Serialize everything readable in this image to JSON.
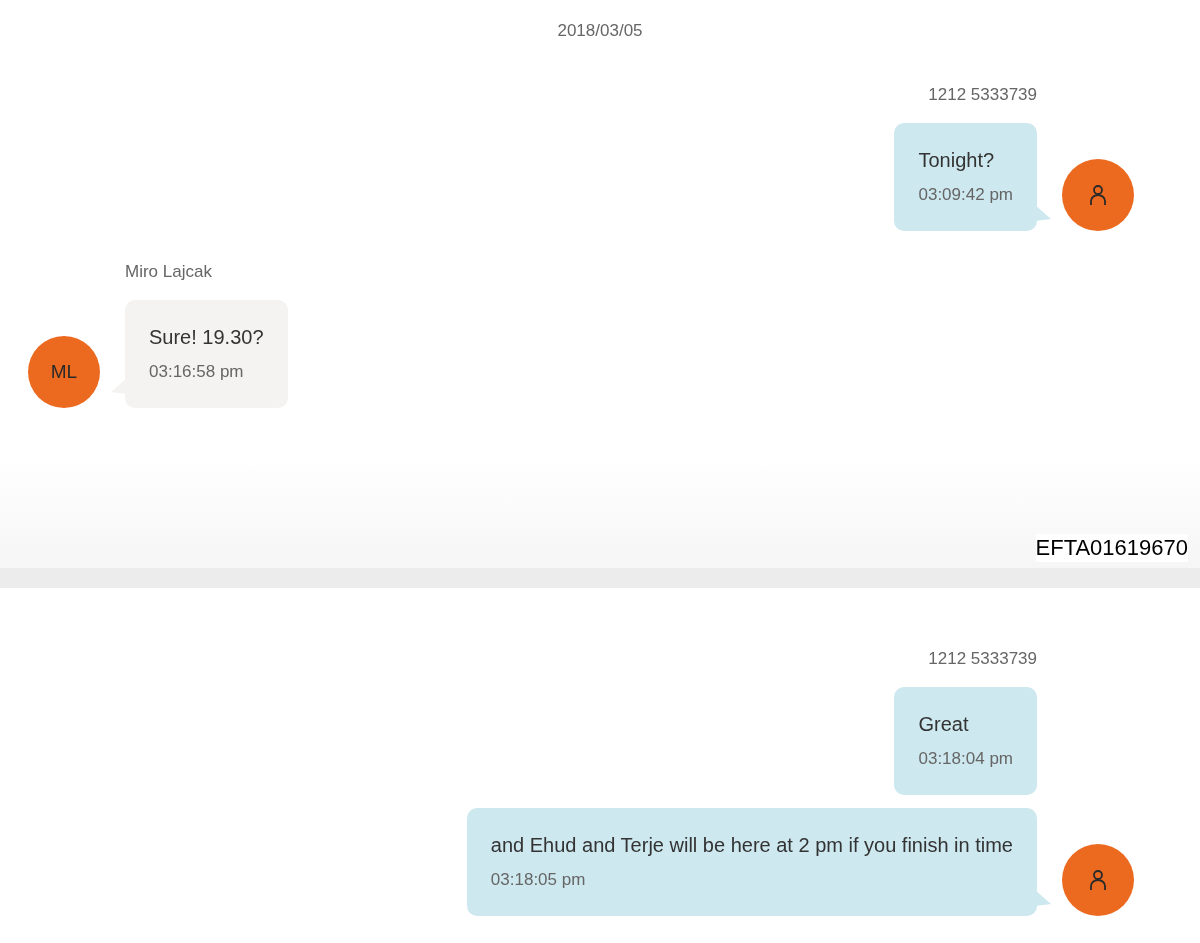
{
  "sections": [
    {
      "date": "2018/03/05",
      "groups": [
        {
          "kind": "outgoing",
          "sender": "1212 5333739",
          "avatar": {
            "kind": "person"
          },
          "messages": [
            {
              "text": "Tonight?",
              "time": "03:09:42 pm"
            }
          ]
        },
        {
          "kind": "incoming",
          "sender": "Miro Lajcak",
          "avatar": {
            "kind": "initials",
            "initials": "ML"
          },
          "messages": [
            {
              "text": "Sure! 19.30?",
              "time": "03:16:58 pm"
            }
          ]
        }
      ]
    },
    {
      "groups": [
        {
          "kind": "outgoing",
          "sender": "1212 5333739",
          "avatar": {
            "kind": "person"
          },
          "messages": [
            {
              "text": "Great",
              "time": "03:18:04 pm"
            },
            {
              "text": "and Ehud and Terje will be here at 2 pm if you finish in time",
              "time": "03:18:05 pm"
            }
          ]
        }
      ]
    }
  ],
  "document_stamp": "EFTA01619670"
}
